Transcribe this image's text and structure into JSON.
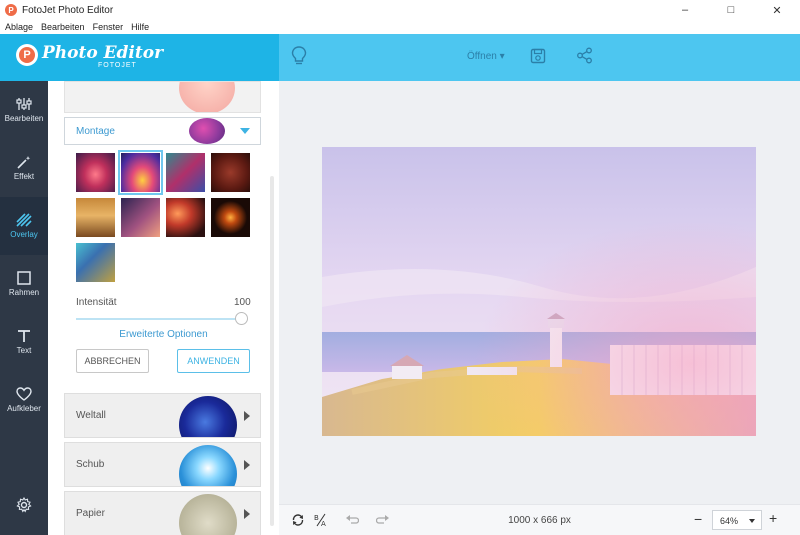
{
  "window": {
    "title": "FotoJet Photo Editor"
  },
  "menu": [
    "Ablage",
    "Bearbeiten",
    "Fenster",
    "Hilfe"
  ],
  "logo": {
    "title": "Photo Editor",
    "sub": "FOTOJET"
  },
  "toolbar": {
    "open_label": "Öffnen"
  },
  "sidebar": {
    "items": [
      {
        "label": "Bearbeiten",
        "icon": "sliders-icon"
      },
      {
        "label": "Effekt",
        "icon": "magic-wand-icon"
      },
      {
        "label": "Overlay",
        "icon": "overlay-stripes-icon"
      },
      {
        "label": "Rahmen",
        "icon": "frame-icon"
      },
      {
        "label": "Text",
        "icon": "text-icon"
      },
      {
        "label": "Aufkleber",
        "icon": "heart-icon"
      }
    ],
    "active": "Overlay"
  },
  "panel": {
    "category_label": "Montage",
    "intensity_label": "Intensität",
    "intensity_value": "100",
    "advanced_label": "Erweiterte Optionen",
    "cancel_label": "ABBRECHEN",
    "apply_label": "ANWENDEN",
    "categories": [
      {
        "label": "Weltall"
      },
      {
        "label": "Schub"
      },
      {
        "label": "Papier"
      }
    ]
  },
  "canvas": {
    "dimensions": "1000 x 666 px"
  },
  "zoom": {
    "value": "64%"
  },
  "colors": {
    "header": "#1eb4e6",
    "header_right": "#4dc6f0",
    "sidebar": "#2e3846",
    "accent": "#3db3e3"
  }
}
